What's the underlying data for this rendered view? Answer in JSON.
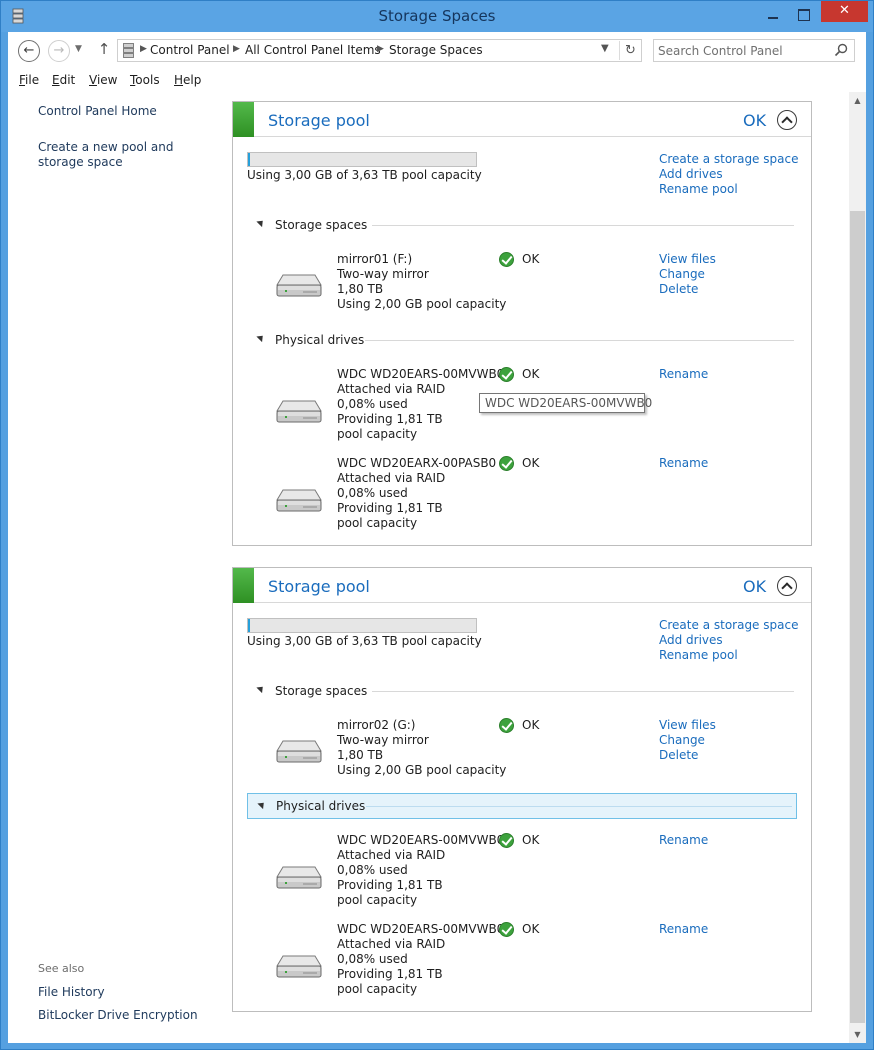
{
  "window": {
    "title": "Storage Spaces"
  },
  "address": {
    "crumbs": [
      "Control Panel",
      "All Control Panel Items",
      "Storage Spaces"
    ],
    "search_placeholder": "Search Control Panel"
  },
  "menu": [
    {
      "first": "F",
      "rest": "ile"
    },
    {
      "first": "E",
      "rest": "dit"
    },
    {
      "first": "V",
      "rest": "iew"
    },
    {
      "first": "T",
      "rest": "ools"
    },
    {
      "first": "H",
      "rest": "elp"
    }
  ],
  "left": {
    "home": "Control Panel Home",
    "create": "Create a new pool and storage space",
    "see_also": "See also",
    "file_history": "File History",
    "bitlocker": "BitLocker Drive Encryption"
  },
  "pools": [
    {
      "title": "Storage pool",
      "status": "OK",
      "capacity_text": "Using 3,00 GB of 3,63 TB pool capacity",
      "capacity_used_fraction": 0.001,
      "links": [
        "Create a storage space",
        "Add drives",
        "Rename pool"
      ],
      "spaces_label": "Storage spaces",
      "space": {
        "lines": [
          "mirror01 (F:)",
          "Two-way mirror",
          "1,80 TB",
          "Using 2,00 GB pool capacity"
        ],
        "status": "OK",
        "links": [
          "View files",
          "Change",
          "Delete"
        ]
      },
      "drives_label": "Physical drives",
      "drives": [
        {
          "lines": [
            "WDC WD20EARS-00MVWB0",
            "Attached via RAID",
            "0,08% used",
            "Providing 1,81 TB pool capacity"
          ],
          "status": "OK",
          "link": "Rename"
        },
        {
          "lines": [
            "WDC WD20EARX-00PASB0",
            "Attached via RAID",
            "0,08% used",
            "Providing 1,81 TB pool capacity"
          ],
          "status": "OK",
          "link": "Rename"
        }
      ]
    },
    {
      "title": "Storage pool",
      "status": "OK",
      "capacity_text": "Using 3,00 GB of 3,63 TB pool capacity",
      "capacity_used_fraction": 0.001,
      "links": [
        "Create a storage space",
        "Add drives",
        "Rename pool"
      ],
      "spaces_label": "Storage spaces",
      "space": {
        "lines": [
          "mirror02 (G:)",
          "Two-way mirror",
          "1,80 TB",
          "Using 2,00 GB pool capacity"
        ],
        "status": "OK",
        "links": [
          "View files",
          "Change",
          "Delete"
        ]
      },
      "drives_label": "Physical drives",
      "drives": [
        {
          "lines": [
            "WDC WD20EARS-00MVWB0",
            "Attached via RAID",
            "0,08% used",
            "Providing 1,81 TB pool capacity"
          ],
          "status": "OK",
          "link": "Rename"
        },
        {
          "lines": [
            "WDC WD20EARS-00MVWB0",
            "Attached via RAID",
            "0,08% used",
            "Providing 1,81 TB pool capacity"
          ],
          "status": "OK",
          "link": "Rename"
        }
      ]
    }
  ],
  "tooltip": "WDC WD20EARS-00MVWB0",
  "colors": {
    "accent": "#1a6cbd",
    "pool_green": "#3aa82f",
    "titlebar": "#5aa4e4",
    "close": "#c7372f"
  }
}
